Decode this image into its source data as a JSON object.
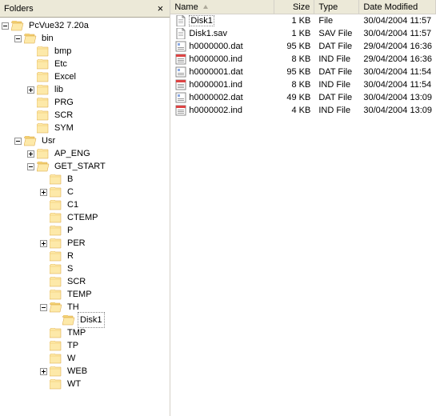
{
  "panel": {
    "title": "Folders"
  },
  "columns": {
    "name": "Name",
    "size": "Size",
    "type": "Type",
    "date": "Date Modified"
  },
  "tree": [
    {
      "depth": 0,
      "exp": "minus",
      "open": true,
      "label": "PcVue32 7.20a"
    },
    {
      "depth": 1,
      "exp": "minus",
      "open": true,
      "label": "bin"
    },
    {
      "depth": 2,
      "exp": "none",
      "open": false,
      "label": "bmp"
    },
    {
      "depth": 2,
      "exp": "none",
      "open": false,
      "label": "Etc"
    },
    {
      "depth": 2,
      "exp": "none",
      "open": false,
      "label": "Excel"
    },
    {
      "depth": 2,
      "exp": "plus",
      "open": false,
      "label": "lib"
    },
    {
      "depth": 2,
      "exp": "none",
      "open": false,
      "label": "PRG"
    },
    {
      "depth": 2,
      "exp": "none",
      "open": false,
      "label": "SCR"
    },
    {
      "depth": 2,
      "exp": "none",
      "open": false,
      "label": "SYM"
    },
    {
      "depth": 1,
      "exp": "minus",
      "open": true,
      "label": "Usr"
    },
    {
      "depth": 2,
      "exp": "plus",
      "open": false,
      "label": "AP_ENG"
    },
    {
      "depth": 2,
      "exp": "minus",
      "open": true,
      "label": "GET_START"
    },
    {
      "depth": 3,
      "exp": "none",
      "open": false,
      "label": "B"
    },
    {
      "depth": 3,
      "exp": "plus",
      "open": false,
      "label": "C"
    },
    {
      "depth": 3,
      "exp": "none",
      "open": false,
      "label": "C1"
    },
    {
      "depth": 3,
      "exp": "none",
      "open": false,
      "label": "CTEMP"
    },
    {
      "depth": 3,
      "exp": "none",
      "open": false,
      "label": "P"
    },
    {
      "depth": 3,
      "exp": "plus",
      "open": false,
      "label": "PER"
    },
    {
      "depth": 3,
      "exp": "none",
      "open": false,
      "label": "R"
    },
    {
      "depth": 3,
      "exp": "none",
      "open": false,
      "label": "S"
    },
    {
      "depth": 3,
      "exp": "none",
      "open": false,
      "label": "SCR"
    },
    {
      "depth": 3,
      "exp": "none",
      "open": false,
      "label": "TEMP"
    },
    {
      "depth": 3,
      "exp": "minus",
      "open": true,
      "label": "TH"
    },
    {
      "depth": 4,
      "exp": "none",
      "open": true,
      "label": "Disk1",
      "selected": true
    },
    {
      "depth": 3,
      "exp": "none",
      "open": false,
      "label": "TMP"
    },
    {
      "depth": 3,
      "exp": "none",
      "open": false,
      "label": "TP"
    },
    {
      "depth": 3,
      "exp": "none",
      "open": false,
      "label": "W"
    },
    {
      "depth": 3,
      "exp": "plus",
      "open": false,
      "label": "WEB"
    },
    {
      "depth": 3,
      "exp": "none",
      "open": false,
      "label": "WT"
    }
  ],
  "files": [
    {
      "name": "Disk1",
      "size": "1 KB",
      "type": "File",
      "date": "30/04/2004 11:57",
      "icon": "file",
      "selected": true
    },
    {
      "name": "Disk1.sav",
      "size": "1 KB",
      "type": "SAV File",
      "date": "30/04/2004 11:57",
      "icon": "file"
    },
    {
      "name": "h0000000.dat",
      "size": "95 KB",
      "type": "DAT File",
      "date": "29/04/2004 16:36",
      "icon": "dat"
    },
    {
      "name": "h0000000.ind",
      "size": "8 KB",
      "type": "IND File",
      "date": "29/04/2004 16:36",
      "icon": "ind"
    },
    {
      "name": "h0000001.dat",
      "size": "95 KB",
      "type": "DAT File",
      "date": "30/04/2004 11:54",
      "icon": "dat"
    },
    {
      "name": "h0000001.ind",
      "size": "8 KB",
      "type": "IND File",
      "date": "30/04/2004 11:54",
      "icon": "ind"
    },
    {
      "name": "h0000002.dat",
      "size": "49 KB",
      "type": "DAT File",
      "date": "30/04/2004 13:09",
      "icon": "dat"
    },
    {
      "name": "h0000002.ind",
      "size": "4 KB",
      "type": "IND File",
      "date": "30/04/2004 13:09",
      "icon": "ind"
    }
  ]
}
